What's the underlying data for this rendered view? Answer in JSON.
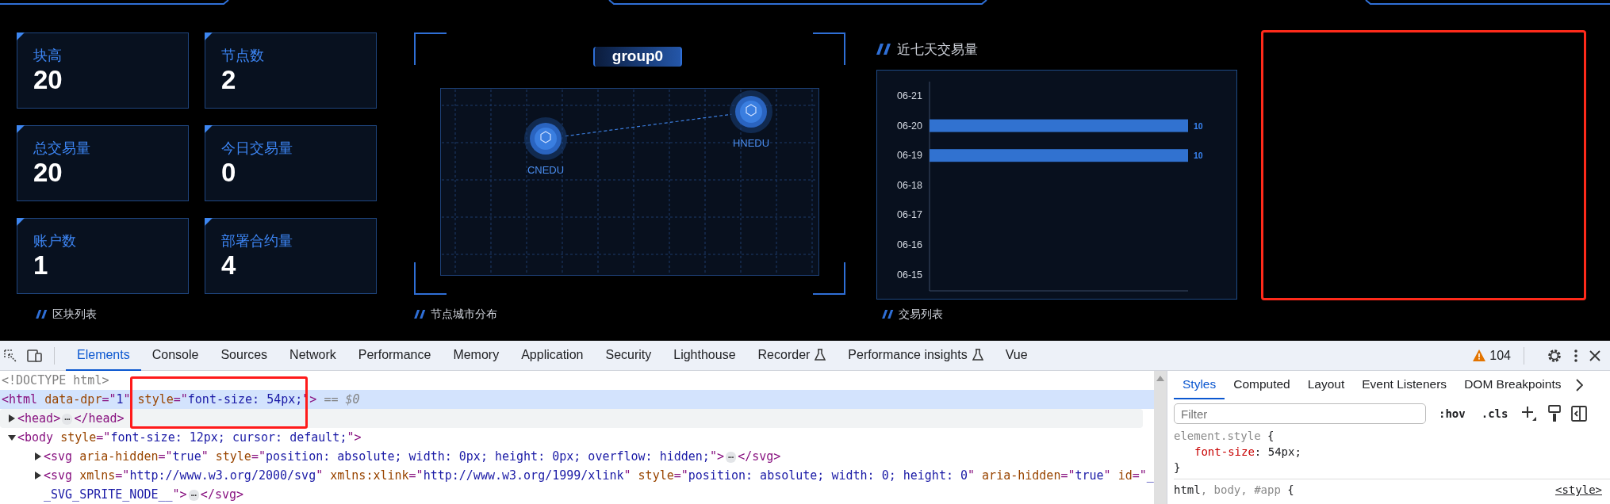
{
  "stats": [
    {
      "label": "块高",
      "value": "20"
    },
    {
      "label": "节点数",
      "value": "2"
    },
    {
      "label": "总交易量",
      "value": "20"
    },
    {
      "label": "今日交易量",
      "value": "0"
    },
    {
      "label": "账户数",
      "value": "1"
    },
    {
      "label": "部署合约量",
      "value": "4"
    }
  ],
  "topology": {
    "group": "group0",
    "nodes": [
      {
        "name": "CNEDU"
      },
      {
        "name": "HNEDU"
      }
    ]
  },
  "tx_chart": {
    "title": "近七天交易量",
    "chart_data": {
      "type": "bar",
      "orientation": "horizontal",
      "categories": [
        "06-21",
        "06-20",
        "06-19",
        "06-18",
        "06-17",
        "06-16",
        "06-15"
      ],
      "values": [
        null,
        10,
        10,
        null,
        null,
        null,
        null
      ],
      "data_labels": true
    }
  },
  "sections": [
    "区块列表",
    "节点城市分布",
    "交易列表"
  ],
  "devtools": {
    "tabs": [
      {
        "label": "Elements",
        "selected": true,
        "experimental": false
      },
      {
        "label": "Console",
        "selected": false,
        "experimental": false
      },
      {
        "label": "Sources",
        "selected": false,
        "experimental": false
      },
      {
        "label": "Network",
        "selected": false,
        "experimental": false
      },
      {
        "label": "Performance",
        "selected": false,
        "experimental": false
      },
      {
        "label": "Memory",
        "selected": false,
        "experimental": false
      },
      {
        "label": "Application",
        "selected": false,
        "experimental": false
      },
      {
        "label": "Security",
        "selected": false,
        "experimental": false
      },
      {
        "label": "Lighthouse",
        "selected": false,
        "experimental": false
      },
      {
        "label": "Recorder",
        "selected": false,
        "experimental": true
      },
      {
        "label": "Performance insights",
        "selected": false,
        "experimental": true
      },
      {
        "label": "Vue",
        "selected": false,
        "experimental": false
      }
    ],
    "warnings": "104",
    "dom_tree": [
      {
        "tokens": [
          {
            "kind": "doctype",
            "text": "<!DOCTYPE html>"
          }
        ],
        "selected": false,
        "hovered": false
      },
      {
        "tokens": [
          {
            "kind": "tag",
            "text": "<html"
          },
          {
            "kind": "attr",
            "text": " data-dpr"
          },
          {
            "kind": "tag",
            "text": "=\""
          },
          {
            "kind": "value",
            "text": "1"
          },
          {
            "kind": "tag",
            "text": "\""
          },
          {
            "kind": "attr",
            "text": " style"
          },
          {
            "kind": "tag",
            "text": "=\""
          },
          {
            "kind": "value",
            "text": "font-size: 54px;"
          },
          {
            "kind": "tag",
            "text": "\">"
          },
          {
            "kind": "marker",
            "text": " == $0"
          }
        ],
        "selected": true,
        "hovered": false,
        "children": [
          {
            "tokens": [
              {
                "kind": "tag",
                "text": "<head>"
              },
              {
                "kind": "ellipsis",
                "text": "⋯"
              },
              {
                "kind": "tag",
                "text": "</head>"
              }
            ],
            "selected": false,
            "hovered": true,
            "expanded": false
          },
          {
            "tokens": [
              {
                "kind": "tag",
                "text": "<body"
              },
              {
                "kind": "attr",
                "text": " style"
              },
              {
                "kind": "tag",
                "text": "=\""
              },
              {
                "kind": "value",
                "text": "font-size: 12px; cursor: default;"
              },
              {
                "kind": "tag",
                "text": "\">"
              }
            ],
            "selected": false,
            "hovered": false,
            "expanded": true,
            "children": [
              {
                "tokens": [
                  {
                    "kind": "tag",
                    "text": "<svg"
                  },
                  {
                    "kind": "attr",
                    "text": " aria-hidden"
                  },
                  {
                    "kind": "tag",
                    "text": "=\""
                  },
                  {
                    "kind": "value",
                    "text": "true"
                  },
                  {
                    "kind": "tag",
                    "text": "\""
                  },
                  {
                    "kind": "attr",
                    "text": " style"
                  },
                  {
                    "kind": "tag",
                    "text": "=\""
                  },
                  {
                    "kind": "value",
                    "text": "position: absolute; width: 0px; height: 0px; overflow: hidden;"
                  },
                  {
                    "kind": "tag",
                    "text": "\">"
                  },
                  {
                    "kind": "ellipsis",
                    "text": "⋯"
                  },
                  {
                    "kind": "tag",
                    "text": "</svg>"
                  }
                ],
                "selected": false,
                "hovered": false,
                "expanded": false
              },
              {
                "tokens": [
                  {
                    "kind": "tag",
                    "text": "<svg"
                  },
                  {
                    "kind": "attr",
                    "text": " xmlns"
                  },
                  {
                    "kind": "tag",
                    "text": "=\""
                  },
                  {
                    "kind": "value",
                    "text": "http://www.w3.org/2000/svg"
                  },
                  {
                    "kind": "tag",
                    "text": "\""
                  },
                  {
                    "kind": "attr",
                    "text": " xmlns:xlink"
                  },
                  {
                    "kind": "tag",
                    "text": "=\""
                  },
                  {
                    "kind": "value",
                    "text": "http://www.w3.org/1999/xlink"
                  },
                  {
                    "kind": "tag",
                    "text": "\""
                  },
                  {
                    "kind": "attr",
                    "text": " style"
                  },
                  {
                    "kind": "tag",
                    "text": "=\""
                  },
                  {
                    "kind": "value",
                    "text": "position: absolute; width: 0; height: 0"
                  },
                  {
                    "kind": "tag",
                    "text": "\""
                  },
                  {
                    "kind": "attr",
                    "text": " aria-hidden"
                  },
                  {
                    "kind": "tag",
                    "text": "=\""
                  },
                  {
                    "kind": "value",
                    "text": "true"
                  },
                  {
                    "kind": "tag",
                    "text": "\""
                  },
                  {
                    "kind": "attr",
                    "text": " id"
                  },
                  {
                    "kind": "tag",
                    "text": "=\""
                  },
                  {
                    "kind": "value",
                    "text": "__SVG_SPRITE_NODE__"
                  },
                  {
                    "kind": "tag",
                    "text": "\">"
                  },
                  {
                    "kind": "ellipsis",
                    "text": "⋯"
                  },
                  {
                    "kind": "tag",
                    "text": "</svg>"
                  }
                ],
                "selected": false,
                "hovered": false,
                "expanded": false
              }
            ]
          }
        ]
      }
    ],
    "side_tabs": [
      {
        "label": "Styles",
        "selected": true
      },
      {
        "label": "Computed",
        "selected": false
      },
      {
        "label": "Layout",
        "selected": false
      },
      {
        "label": "Event Listeners",
        "selected": false
      },
      {
        "label": "DOM Breakpoints",
        "selected": false
      }
    ],
    "filter": {
      "placeholder": "Filter"
    },
    "filter_buttons": [
      ":hov",
      ".cls"
    ],
    "style_lines": [
      {
        "kind": "rule-start",
        "tokens": [
          {
            "kind": "selector-dim",
            "text": "element.style"
          },
          {
            "kind": "plain",
            "text": " {"
          }
        ]
      },
      {
        "kind": "declaration",
        "tokens": [
          {
            "kind": "property",
            "text": "font-size"
          },
          {
            "kind": "plain",
            "text": ": 54px;"
          }
        ]
      },
      {
        "kind": "rule-end",
        "tokens": [
          {
            "kind": "plain",
            "text": "}"
          }
        ]
      },
      {
        "kind": "rule-start",
        "tokens": [
          {
            "kind": "selector",
            "text": "html"
          },
          {
            "kind": "selector-dim",
            "text": ", body, #app"
          },
          {
            "kind": "plain",
            "text": " {"
          }
        ],
        "source": "<style>"
      }
    ]
  }
}
